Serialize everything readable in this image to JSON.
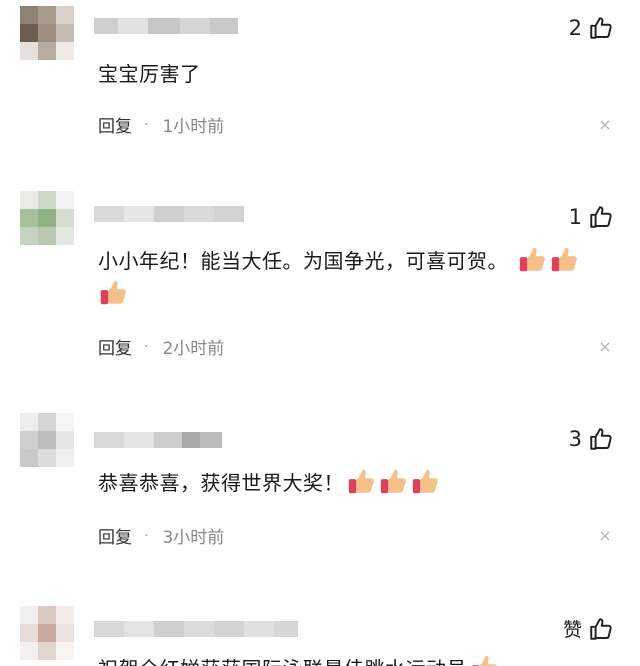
{
  "comments": [
    {
      "likes": "2",
      "text": "宝宝厉害了",
      "reply_label": "回复",
      "separator": "·",
      "time": "1小时前",
      "close_symbol": "×",
      "emoji_count": 0
    },
    {
      "likes": "1",
      "text": "小小年纪！能当大任。为国争光，可喜可贺。",
      "reply_label": "回复",
      "separator": "·",
      "time": "2小时前",
      "close_symbol": "×",
      "emoji_count": 3
    },
    {
      "likes": "3",
      "text": "恭喜恭喜，获得世界大奖！",
      "reply_label": "回复",
      "separator": "·",
      "time": "3小时前",
      "close_symbol": "×",
      "emoji_count": 3
    },
    {
      "likes": "赞",
      "text": "祝贺全红婵获获国际泳联最佳跳水运动员",
      "emoji_count": 1
    }
  ],
  "icons": {
    "like": "thumbs-up-icon",
    "emoji": "thumbs-up-emoji-icon",
    "close": "close-icon"
  },
  "colors": {
    "text": "#1a1a1a",
    "meta": "#888888",
    "emoji_skin": "#f5c08a",
    "emoji_cuff": "#e0405a"
  }
}
